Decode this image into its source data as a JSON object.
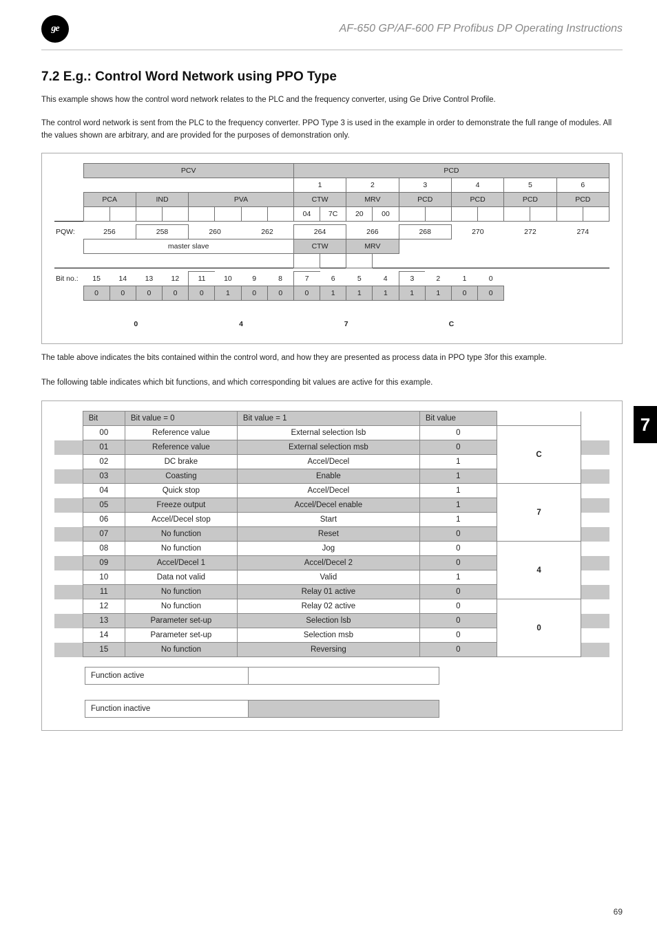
{
  "header": {
    "logo_text": "ge",
    "doc_title": "AF-650 GP/AF-600 FP Profibus DP Operating Instructions"
  },
  "section": {
    "number_title": "7.2  E.g.: Control Word Network using PPO Type",
    "para1": "This example shows how the control word network relates to the PLC and the frequency converter, using Ge Drive Control Profile.",
    "para2": "The control word network is sent from the PLC to the frequency converter. PPO Type 3 is used in the example in order to demonstrate the full range of modules. All the values shown are arbitrary, and are provided for the purposes of demonstration only.",
    "caption1": "The table above indicates the bits contained within the control word, and how they are presented as process data in PPO type 3for this example.",
    "caption2": "The following table indicates which bit functions, and which corresponding bit values are active for this example."
  },
  "pcv": {
    "header_pcv": "PCV",
    "header_pcd": "PCD",
    "col_nums": [
      "1",
      "2",
      "3",
      "4",
      "5",
      "6"
    ],
    "pca": "PCA",
    "ind": "IND",
    "pva": "PVA",
    "ctw": "CTW",
    "mrv": "MRV",
    "pcd": "PCD",
    "row04": [
      "04",
      "7C",
      "20",
      "00"
    ],
    "pqw_label": "PQW:",
    "pqw_vals": [
      "256",
      "258",
      "260",
      "262",
      "264",
      "266",
      "268",
      "270",
      "272",
      "274"
    ],
    "master_slave": "master slave",
    "ctw_row": "CTW",
    "mrv_row": "MRV",
    "bitno_label": "Bit no.:",
    "bits": [
      "15",
      "14",
      "13",
      "12",
      "11",
      "10",
      "9",
      "8",
      "7",
      "6",
      "5",
      "4",
      "3",
      "2",
      "1",
      "0"
    ],
    "bitvals": [
      "0",
      "0",
      "0",
      "0",
      "0",
      "1",
      "0",
      "0",
      "0",
      "1",
      "1",
      "1",
      "1",
      "1",
      "0",
      "0"
    ],
    "bottom": [
      "0",
      "4",
      "7",
      "C"
    ]
  },
  "bit_table": {
    "headers": [
      "Bit",
      "Bit value = 0",
      "Bit value = 1",
      "Bit value"
    ],
    "rows": [
      {
        "bit": "00",
        "v0": "Reference value",
        "v1": "External selection lsb",
        "val": "0",
        "grp": "C",
        "odd": false
      },
      {
        "bit": "01",
        "v0": "Reference value",
        "v1": "External selection msb",
        "val": "0",
        "odd": true
      },
      {
        "bit": "02",
        "v0": "DC brake",
        "v1": "Accel/Decel",
        "val": "1",
        "odd": false
      },
      {
        "bit": "03",
        "v0": "Coasting",
        "v1": "Enable",
        "val": "1",
        "odd": true
      },
      {
        "bit": "04",
        "v0": "Quick stop",
        "v1": "Accel/Decel",
        "val": "1",
        "grp": "7",
        "odd": false
      },
      {
        "bit": "05",
        "v0": "Freeze output",
        "v1": "Accel/Decel enable",
        "val": "1",
        "odd": true
      },
      {
        "bit": "06",
        "v0": "Accel/Decel stop",
        "v1": "Start",
        "val": "1",
        "odd": false
      },
      {
        "bit": "07",
        "v0": "No function",
        "v1": "Reset",
        "val": "0",
        "odd": true
      },
      {
        "bit": "08",
        "v0": "No function",
        "v1": "Jog",
        "val": "0",
        "grp": "4",
        "odd": false
      },
      {
        "bit": "09",
        "v0": "Accel/Decel 1",
        "v1": "Accel/Decel 2",
        "val": "0",
        "odd": true
      },
      {
        "bit": "10",
        "v0": "Data not valid",
        "v1": "Valid",
        "val": "1",
        "odd": false
      },
      {
        "bit": "11",
        "v0": "No function",
        "v1": "Relay 01 active",
        "val": "0",
        "odd": true
      },
      {
        "bit": "12",
        "v0": "No function",
        "v1": "Relay 02 active",
        "val": "0",
        "grp": "0",
        "odd": false
      },
      {
        "bit": "13",
        "v0": "Parameter set-up",
        "v1": "Selection lsb",
        "val": "0",
        "odd": true
      },
      {
        "bit": "14",
        "v0": "Parameter set-up",
        "v1": "Selection msb",
        "val": "0",
        "odd": false
      },
      {
        "bit": "15",
        "v0": "No function",
        "v1": "Reversing",
        "val": "0",
        "odd": true
      }
    ],
    "func_active": "Function active",
    "func_inactive": "Function inactive"
  },
  "side_tab": "7",
  "page_number": "69"
}
